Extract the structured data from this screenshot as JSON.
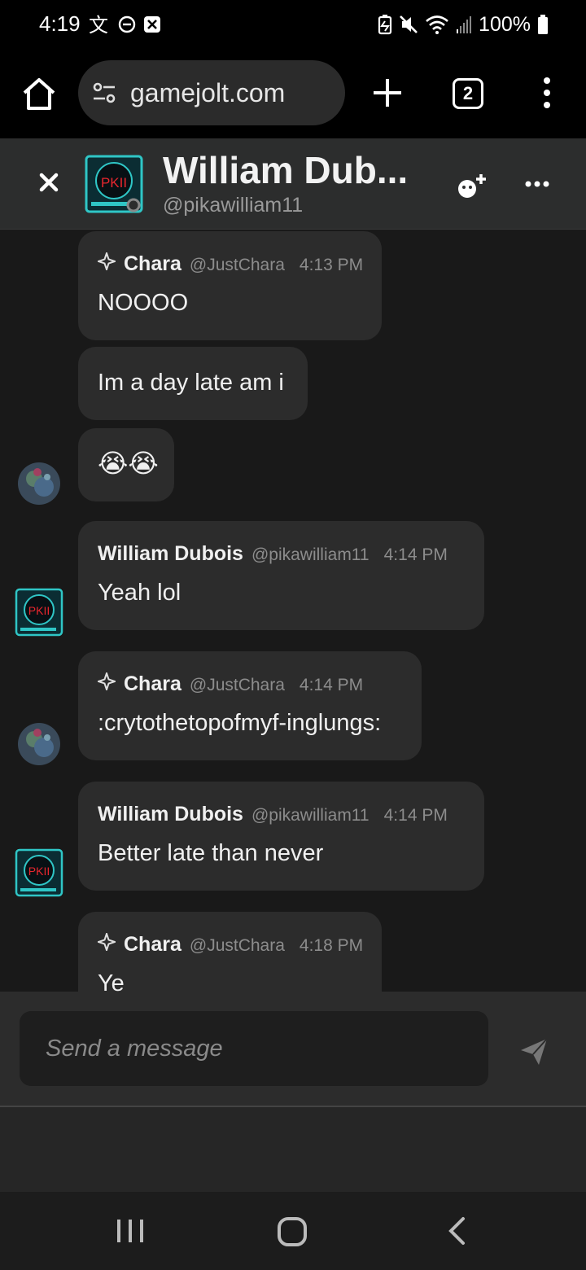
{
  "status_bar": {
    "time": "4:19",
    "battery": "100%",
    "left_icons": [
      "translate-icon",
      "dnd-icon",
      "notification-icon"
    ],
    "right_icons": [
      "battery-saver-icon",
      "mute-icon",
      "wifi-icon",
      "signal-icon",
      "battery-icon"
    ]
  },
  "browser": {
    "url": "gamejolt.com",
    "tab_count": "2"
  },
  "chat_header": {
    "title": "William Dub...",
    "handle": "@pikawilliam11",
    "avatar_text": "PKII"
  },
  "messages": [
    {
      "author": "Chara",
      "handle": "@JustChara",
      "time": "4:13 PM",
      "text": "NOOOO",
      "has_meta": true,
      "sparkle": true
    },
    {
      "text": "Im a day late am i",
      "has_meta": false
    },
    {
      "text": "😭😭",
      "has_meta": false
    },
    {
      "author": "William Dubois",
      "handle": "@pikawilliam11",
      "time": "4:14 PM",
      "text": "Yeah lol",
      "has_meta": true,
      "sparkle": false
    },
    {
      "author": "Chara",
      "handle": "@JustChara",
      "time": "4:14 PM",
      "text": ":crytothetopofmyf-inglungs:",
      "has_meta": true,
      "sparkle": true
    },
    {
      "author": "William Dubois",
      "handle": "@pikawilliam11",
      "time": "4:14 PM",
      "text": "Better late than never",
      "has_meta": true,
      "sparkle": false
    },
    {
      "author": "Chara",
      "handle": "@JustChara",
      "time": "4:18 PM",
      "text": "Ye",
      "has_meta": true,
      "sparkle": true
    }
  ],
  "composer": {
    "placeholder": "Send a message"
  },
  "colors": {
    "background": "#191919",
    "bubble": "#2c2c2c",
    "header": "#2c2d2d",
    "pk_teal": "#2fc6c6",
    "pk_red": "#e8262e"
  }
}
